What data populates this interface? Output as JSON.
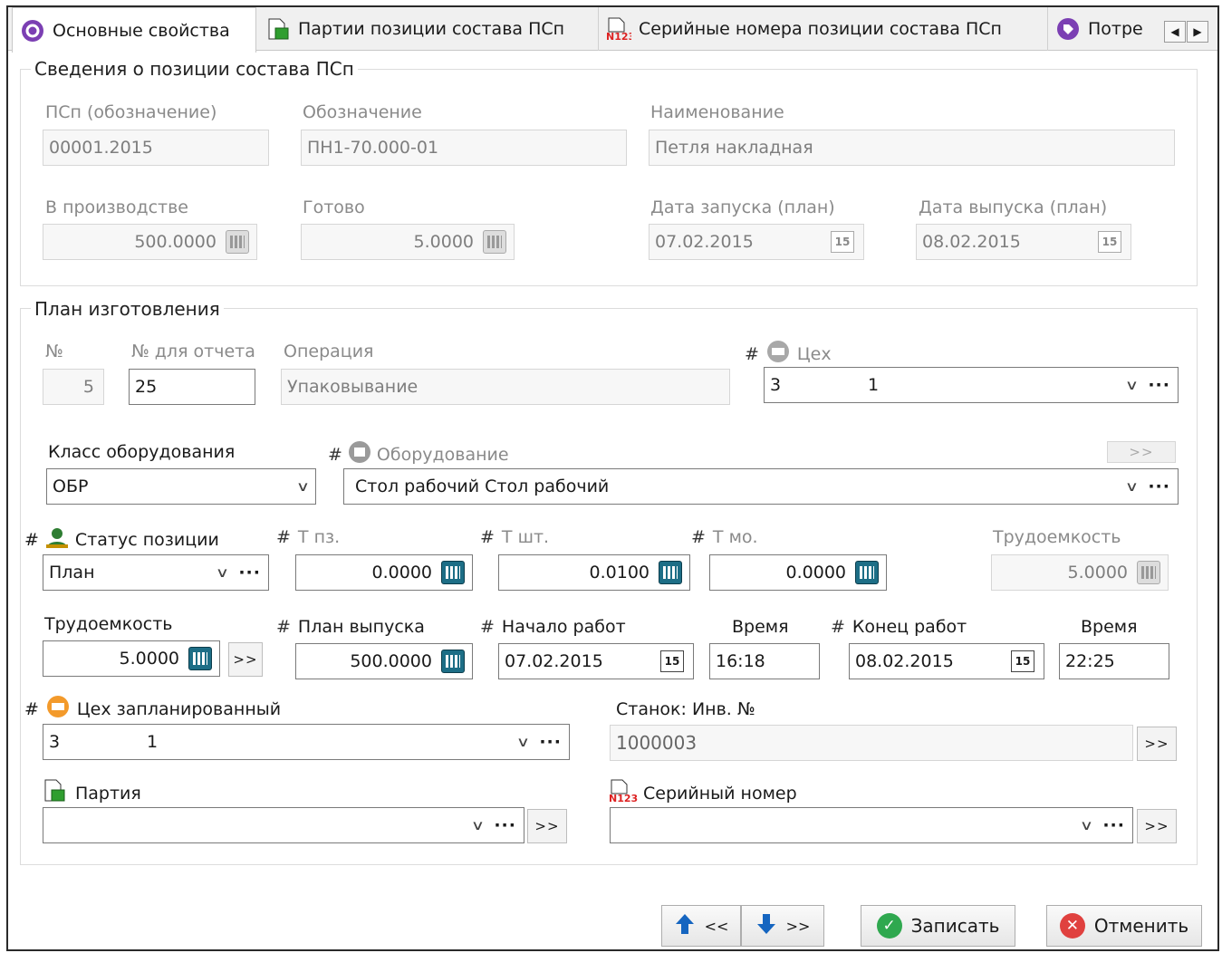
{
  "tabs": [
    {
      "label": "Основные свойства",
      "icon": "properties-icon"
    },
    {
      "label": "Партии позиции состава ПСп",
      "icon": "batch-icon"
    },
    {
      "label": "Серийные номера позиции состава ПСп",
      "icon": "serial-icon"
    },
    {
      "label": "Потре",
      "icon": "tag-icon"
    }
  ],
  "tab_scroll": {
    "left": "◀",
    "right": "▶"
  },
  "info": {
    "title": "Сведения о позиции состава ПСп",
    "psp_label": "ПСп (обозначение)",
    "psp_value": "00001.2015",
    "designation_label": "Обозначение",
    "designation_value": "ПН1-70.000-01",
    "name_label": "Наименование",
    "name_value": "Петля накладная",
    "in_prod_label": "В производстве",
    "in_prod_value": "500.0000",
    "ready_label": "Готово",
    "ready_value": "5.0000",
    "start_label": "Дата запуска (план)",
    "start_value": "07.02.2015",
    "release_label": "Дата выпуска (план)",
    "release_value": "08.02.2015"
  },
  "plan": {
    "title": "План изготовления",
    "num_label": "№",
    "num_value": "5",
    "report_num_label": "№ для отчета",
    "report_num_value": "25",
    "operation_label": "Операция",
    "operation_value": "Упаковывание",
    "shop_label": "Цех",
    "shop_code": "3",
    "shop_value": "1",
    "equip_class_label": "Класс оборудования",
    "equip_class_value": "ОБР",
    "equipment_label": "Оборудование",
    "equipment_value": "Стол рабочий  Стол рабочий",
    "status_label": "Статус позиции",
    "status_value": "План",
    "tpz_label": "Т пз.",
    "tpz_value": "0.0000",
    "tsht_label": "Т шт.",
    "tsht_value": "0.0100",
    "tmo_label": "Т мо.",
    "tmo_value": "0.0000",
    "labor_dis_label": "Трудоемкость",
    "labor_dis_value": "5.0000",
    "labor_label": "Трудоемкость",
    "labor_value": "5.0000",
    "release_plan_label": "План выпуска",
    "release_plan_value": "500.0000",
    "work_start_label": "Начало работ",
    "work_start_value": "07.02.2015",
    "time1_label": "Время",
    "time1_value": "16:18",
    "work_end_label": "Конец работ",
    "work_end_value": "08.02.2015",
    "time2_label": "Время",
    "time2_value": "22:25",
    "planned_shop_label": "Цех запланированный",
    "planned_shop_code": "3",
    "planned_shop_value": "1",
    "machine_label": "Станок: Инв. №",
    "machine_value": "1000003",
    "batch_label": "Партия",
    "batch_value": "",
    "serial_label": "Серийный номер",
    "serial_value": ""
  },
  "glyphs": {
    "chev": "∨",
    "dots": "···",
    "more": ">>",
    "cal": "15",
    "prev": "<<",
    "next": ">>",
    "hash": "#"
  },
  "footer": {
    "save": "Записать",
    "cancel": "Отменить"
  },
  "colors": {
    "calc": "#1d6e86",
    "save": "#2fa84f",
    "cancel": "#e0413f",
    "nav": "#1565c0"
  }
}
